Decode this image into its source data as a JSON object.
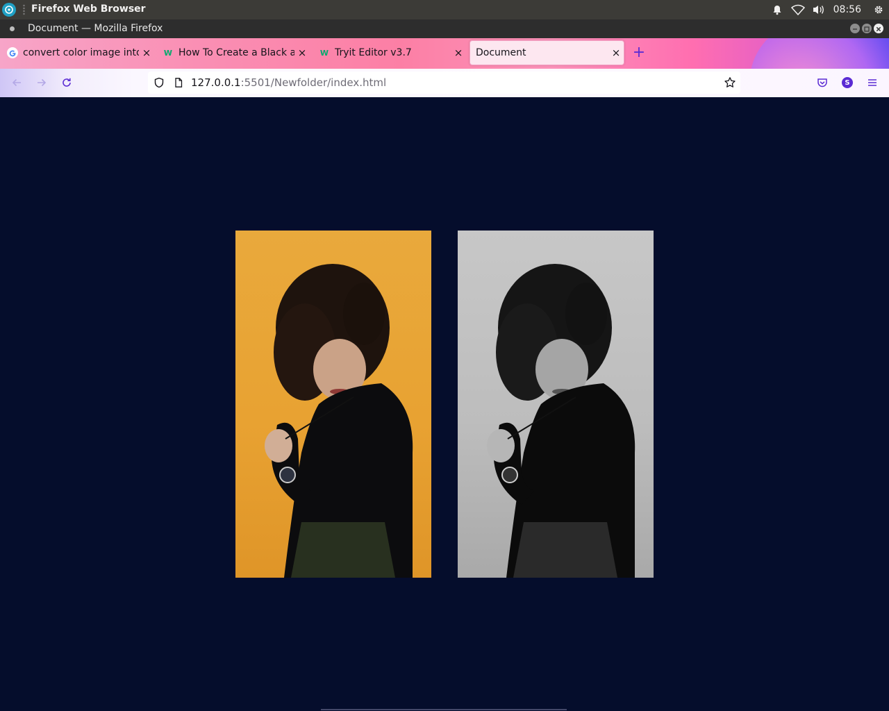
{
  "system_bar": {
    "app_title": "Firefox Web Browser",
    "clock": "08:56",
    "icons": [
      "ubuntu-launcher-icon",
      "bell-icon",
      "wifi-icon",
      "volume-icon",
      "settings-gear-icon"
    ]
  },
  "window": {
    "title": "Document — Mozilla Firefox"
  },
  "tabs": [
    {
      "label": "convert color image into black",
      "favicon": "G",
      "active": false
    },
    {
      "label": "How To Create a Black and White",
      "favicon": "W",
      "active": false
    },
    {
      "label": "Tryit Editor v3.7",
      "favicon": "W",
      "active": false
    },
    {
      "label": "Document",
      "favicon": "",
      "active": true
    }
  ],
  "new_tab_label": "+",
  "address_bar": {
    "host": "127.0.0.1",
    "rest": ":5501/Newfolder/index.html"
  },
  "profile_initial": "S",
  "colors": {
    "page_background": "#050d2c",
    "color_photo_background": "#e8a232",
    "bw_photo_background": "#bdbdbd"
  },
  "images": [
    {
      "name": "color-portrait",
      "variant": "color"
    },
    {
      "name": "grayscale-portrait",
      "variant": "grayscale"
    }
  ]
}
